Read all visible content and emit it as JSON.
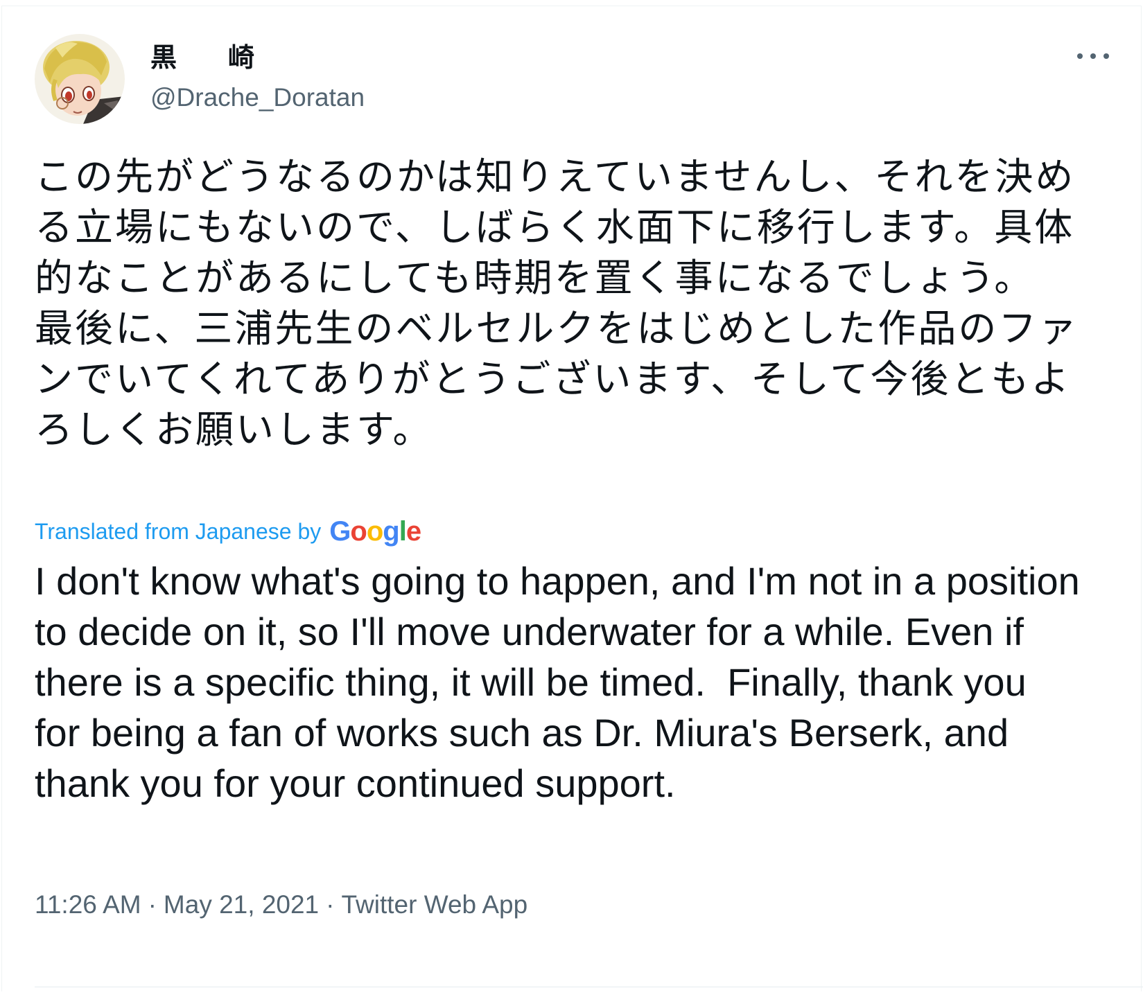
{
  "tweet": {
    "author": {
      "display_name": "黒　崎",
      "handle": "@Drache_Doratan"
    },
    "more_icon": "more-horizontal-icon",
    "original_text": "この先がどうなるのかは知りえていませんし、それを決める立場にもないので、しばらく水面下に移行します。具体的なことがあるにしても時期を置く事になるでしょう。\n最後に、三浦先生のベルセルクをはじめとした作品のファンでいてくれてありがとうございます、そして今後ともよろしくお願いします。",
    "translation": {
      "label": "Translated from Japanese by",
      "provider": "Google",
      "text": "I don't know what's going to happen, and I'm not in a position to decide on it, so I'll move underwater for a while. Even if there is a specific thing, it will be timed.  Finally, thank you for being a fan of works such as Dr. Miura's Berserk, and thank you for your continued support."
    },
    "time": "11:26 AM",
    "date": "May 21, 2021",
    "source": "Twitter Web App",
    "separator": "·"
  },
  "colors": {
    "text_primary": "#0f1419",
    "text_secondary": "#536471",
    "link": "#1d9bf0",
    "google_blue": "#4285f4",
    "google_red": "#ea4335",
    "google_yellow": "#fbbc05",
    "google_green": "#34a853"
  }
}
